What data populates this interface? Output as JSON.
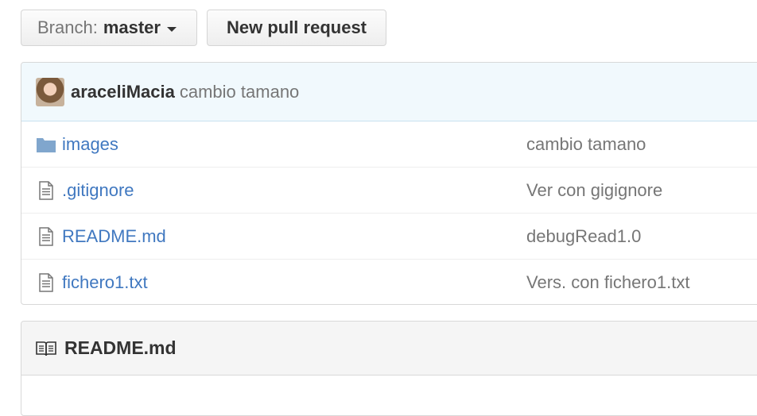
{
  "toolbar": {
    "branch_prefix": "Branch:",
    "branch_name": "master",
    "new_pr_label": "New pull request"
  },
  "commit": {
    "author": "araceliMacia",
    "message": "cambio tamano"
  },
  "files": [
    {
      "type": "folder",
      "icon": "folder-icon",
      "name": "images",
      "message": "cambio tamano"
    },
    {
      "type": "file",
      "icon": "file-icon",
      "name": ".gitignore",
      "message": "Ver con gigignore"
    },
    {
      "type": "file",
      "icon": "file-icon",
      "name": "README.md",
      "message": "debugRead1.0"
    },
    {
      "type": "file",
      "icon": "file-icon",
      "name": "fichero1.txt",
      "message": "Vers. con fichero1.txt"
    }
  ],
  "readme": {
    "icon": "book-icon",
    "title": "README.md"
  },
  "colors": {
    "link": "#4078c0",
    "muted": "#767676",
    "commit_bar_bg": "#f1f9fd",
    "folder_icon": "#80a6cd"
  }
}
